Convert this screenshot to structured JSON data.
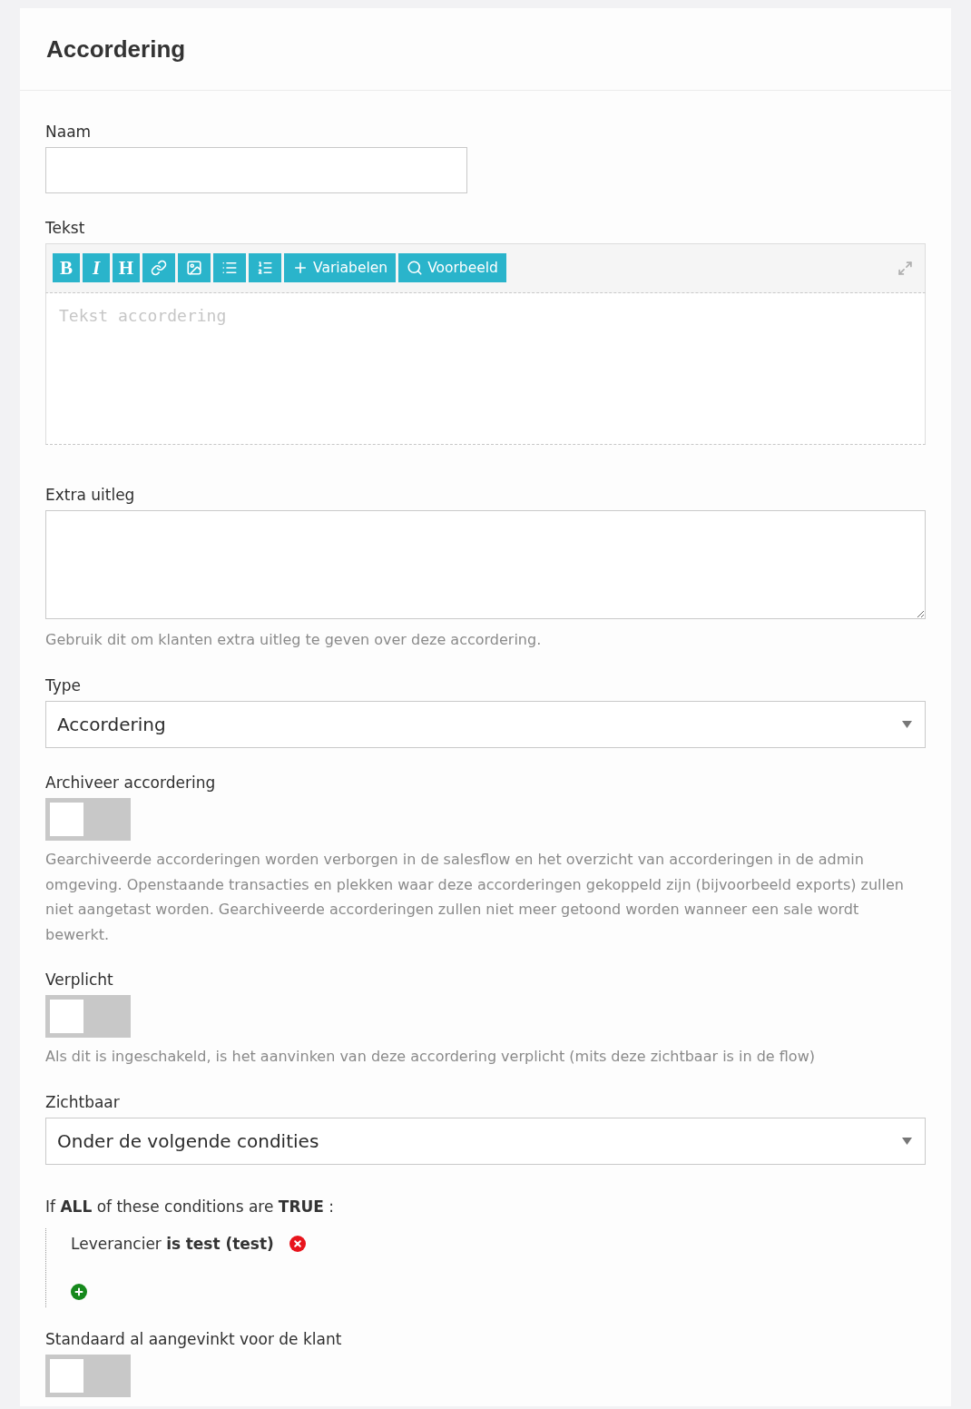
{
  "header": {
    "title": "Accordering"
  },
  "fields": [
    {
      "kind": "input",
      "label": "Naam"
    },
    {
      "kind": "editor",
      "label": "Tekst",
      "placeholder": "Tekst accordering",
      "toolbar": [
        {
          "kind": "bold",
          "glyph": "B"
        },
        {
          "kind": "italic",
          "glyph": "I"
        },
        {
          "kind": "heading",
          "glyph": "H"
        },
        {
          "kind": "link"
        },
        {
          "kind": "image"
        },
        {
          "kind": "bullets"
        },
        {
          "kind": "numbers"
        },
        {
          "kind": "variables",
          "label": "Variabelen"
        },
        {
          "kind": "preview",
          "label": "Voorbeeld"
        }
      ]
    },
    {
      "kind": "textarea",
      "label": "Extra uitleg",
      "help": "Gebruik dit om klanten extra uitleg te geven over deze accordering."
    },
    {
      "kind": "select",
      "label": "Type",
      "value": "Accordering"
    },
    {
      "kind": "toggle",
      "label": "Archiveer accordering",
      "on": false,
      "help": "Gearchiveerde accorderingen worden verborgen in de salesflow en het overzicht van accorderingen in de admin omgeving. Openstaande transacties en plekken waar deze accorderingen gekoppeld zijn (bijvoorbeeld exports) zullen niet aangetast worden. Gearchiveerde accorderingen zullen niet meer getoond worden wanneer een sale wordt bewerkt."
    },
    {
      "kind": "toggle",
      "label": "Verplicht",
      "on": false,
      "help": "Als dit is ingeschakeld, is het aanvinken van deze accordering verplicht (mits deze zichtbaar is in de flow)"
    },
    {
      "kind": "select",
      "label": "Zichtbaar",
      "value": "Onder de volgende condities"
    },
    {
      "kind": "conditions",
      "summary": "If **ALL** of these conditions are **TRUE** :",
      "rules": [
        {
          "text": "Leverancier **is** **test (test)**"
        }
      ]
    },
    {
      "kind": "toggle",
      "label": "Standaard al aangevinkt voor de klant",
      "on": false
    }
  ]
}
